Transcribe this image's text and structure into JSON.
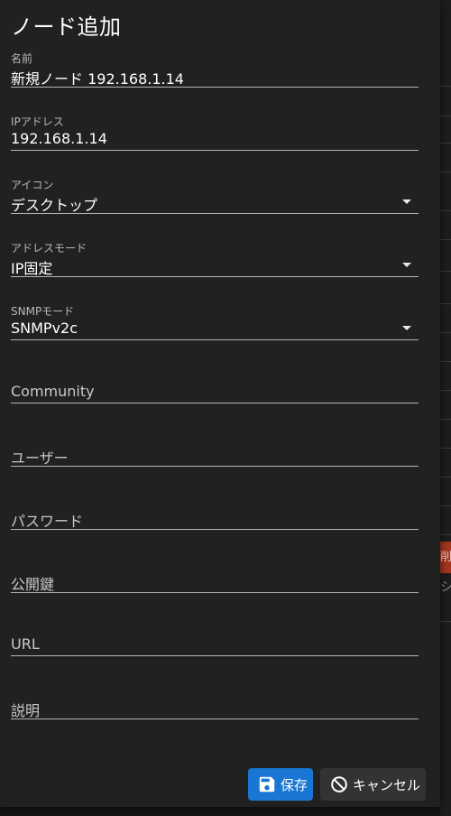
{
  "dialog": {
    "title": "ノード追加"
  },
  "fields": {
    "name": {
      "label": "名前",
      "value": "新規ノード 192.168.1.14"
    },
    "ip": {
      "label": "IPアドレス",
      "value": "192.168.1.14"
    },
    "icon": {
      "label": "アイコン",
      "value": "デスクトップ"
    },
    "address_mode": {
      "label": "アドレスモード",
      "value": "IP固定"
    },
    "snmp_mode": {
      "label": "SNMPモード",
      "value": "SNMPv2c"
    },
    "community": {
      "placeholder": "Community"
    },
    "user": {
      "placeholder": "ユーザー"
    },
    "password": {
      "placeholder": "パスワード"
    },
    "public_key": {
      "placeholder": "公開鍵"
    },
    "url": {
      "placeholder": "URL"
    },
    "description": {
      "placeholder": "説明"
    }
  },
  "actions": {
    "save_label": "保存",
    "save_icon": "floppy-disk-icon",
    "cancel_label": "キャンセル",
    "cancel_icon": "block-icon"
  },
  "background": {
    "badge_text": "削",
    "side_glyph": "シ"
  },
  "colors": {
    "dialog_bg": "#212121",
    "primary": "#1976d2",
    "danger": "#a5351e"
  }
}
